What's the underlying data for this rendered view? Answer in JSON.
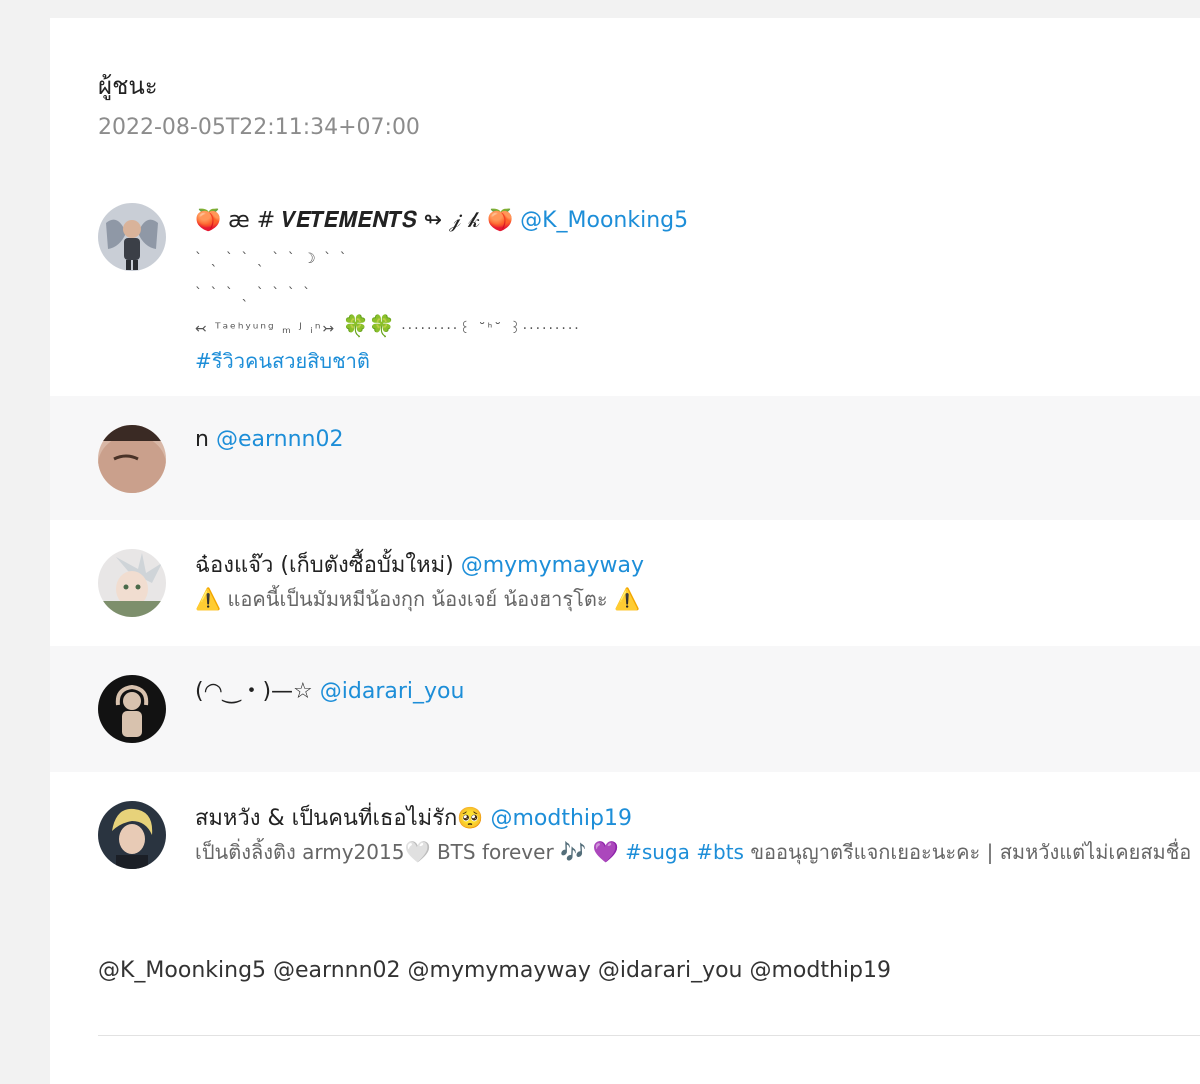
{
  "post": {
    "title": "ผู้ชนะ",
    "timestamp": "2022-08-05T22:11:34+07:00"
  },
  "users": [
    {
      "avatar": "avatar-boy-with-wings",
      "name_prefix_emoji": "🍑",
      "name": "æ # 𝑽𝑬𝑻𝑬𝑴𝑬𝑵𝑻𝑺 ↬ 𝒿 𝓀",
      "name_suffix_emoji": "🍑",
      "handle": "@K_Moonking5",
      "bio_line1": "ˋ ˎ ˋ ˋ ˎ ˋ ˋ ☽ ˋ ˋ",
      "bio_line2": "ˋ ˋ ˋ ˎ ˋ ˋ ˋ ˋ",
      "bio_line3_a": "↢ ᵀᵃᵉʰʸᵘⁿᵍ ₘ ᴶ ᵢⁿ↣",
      "bio_line3_emoji": "🍀🍀",
      "bio_line3_b": "·········꒰ ˘ᑋ˘ ꒱·········",
      "bio_hashtag": "#รีวิวคนสวยสิบชาติ"
    },
    {
      "avatar": "avatar-closeup-face",
      "name": "n",
      "handle": "@earnnn02"
    },
    {
      "avatar": "avatar-anime-character",
      "name": "ฉ๋องแจ๊ว (เก็บตังซื้อบั้มใหม่)",
      "handle": "@mymymayway",
      "bio_emoji_start": "⚠️",
      "bio": "แอคนี้เป็นมัมหมีน้องกุก น้องเจย์ น้องฮารุโตะ",
      "bio_emoji_end": "⚠️"
    },
    {
      "avatar": "avatar-person-dark",
      "name": "(◠‿・)—☆",
      "handle": "@idarari_you"
    },
    {
      "avatar": "avatar-blond-idol",
      "name": "สมหวัง & เป็นคนที่เธอไม่รัก",
      "name_emoji": "🥺",
      "handle": "@modthip19",
      "bio_a": "เป็นติ่งลิ้งติง army2015",
      "bio_heart": "🤍",
      "bio_b": "BTS forever",
      "bio_music": "🎶",
      "bio_purple": "💜",
      "bio_tag1": "#suga",
      "bio_tag2": "#bts",
      "bio_c": "ขออนุญาตรีแจกเยอะนะคะ | สมหวังแต่ไม่เคยสมชื่อ"
    }
  ],
  "mentions": "@K_Moonking5 @earnnn02 @mymymayway @idarari_you @modthip19"
}
